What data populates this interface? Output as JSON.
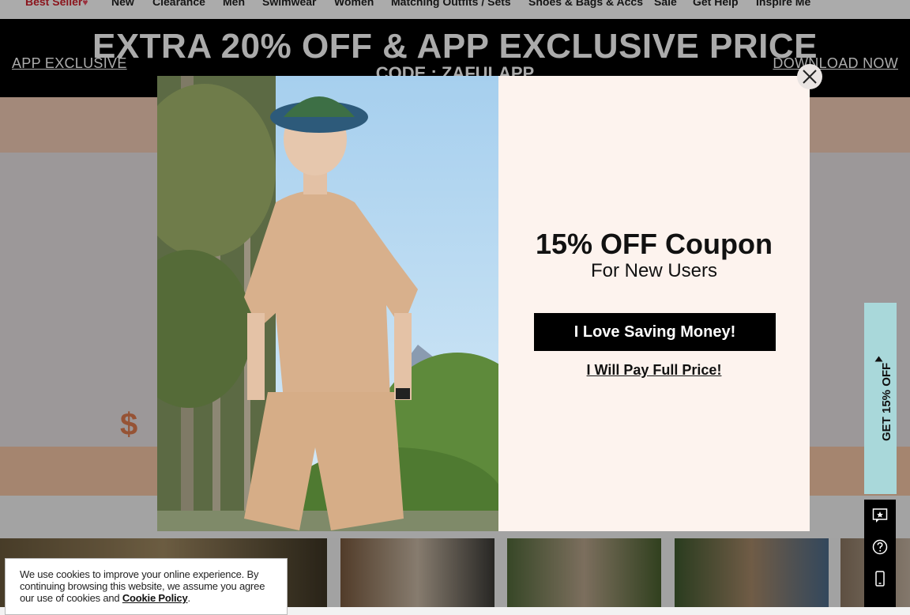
{
  "nav": {
    "items": [
      "Best Seller",
      "New",
      "Clearance",
      "Men",
      "Swimwear",
      "Women",
      "Matching Outfits / Sets",
      "Shoes & Bags & Accs",
      "Sale",
      "Get Help",
      "Inspire Me"
    ]
  },
  "app_banner": {
    "left_link": "APP EXCLUSIVE",
    "headline": "EXTRA 20% OFF & APP EXCLUSIVE PRICE",
    "code": "CODE : ZAFULAPP",
    "right_link": "DOWNLOAD NOW"
  },
  "modal": {
    "title": "15% OFF Coupon",
    "subtitle": "For New Users",
    "accept_button": "I Love Saving Money!",
    "decline_link": "I Will Pay Full Price!",
    "close_icon": "close-icon"
  },
  "side_tab": {
    "label": "GET 15% OFF"
  },
  "side_tools": {
    "icons": [
      "review-star-icon",
      "help-circle-icon",
      "mobile-phone-icon"
    ]
  },
  "cookie": {
    "text": "We use cookies to improve your online experience. By continuing browsing this website, we assume you agree our use of cookies and",
    "link": "Cookie Policy",
    "end": "."
  },
  "colors": {
    "accent_red": "#d0202c",
    "banner_bg": "#000000",
    "modal_bg": "#fdf3ee",
    "side_tab_bg": "#a9d8da"
  }
}
